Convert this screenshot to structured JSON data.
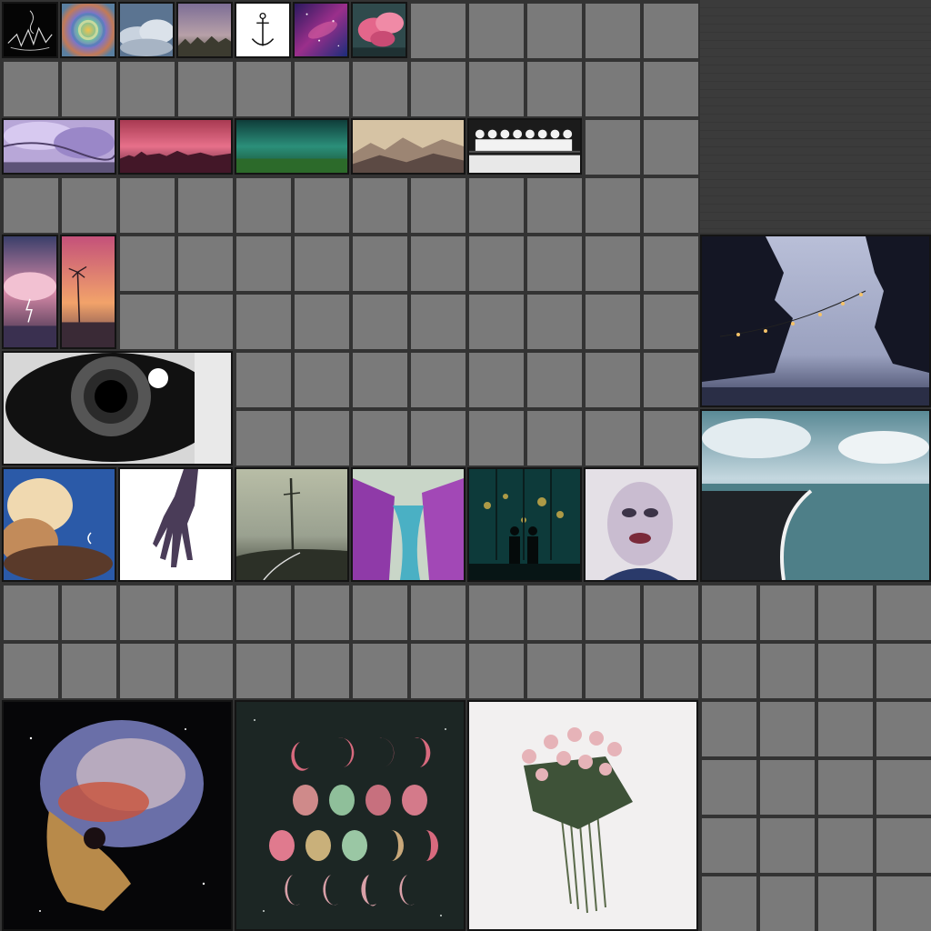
{
  "board": {
    "grid_color": "#333333",
    "cell_color": "#7a7a7a",
    "dark_area_color": "#3b3b3b",
    "tiles": [
      {
        "name": "sketch-tile",
        "icon": "line-sketch"
      },
      {
        "name": "iridescent-swirl-tile",
        "icon": "swirl"
      },
      {
        "name": "clouds-tile",
        "icon": "clouds"
      },
      {
        "name": "purple-haze-tile",
        "icon": "haze"
      },
      {
        "name": "anchor-tile",
        "icon": "anchor-icon"
      },
      {
        "name": "galaxy-tile",
        "icon": "galaxy"
      },
      {
        "name": "pink-smoke-tile",
        "icon": "smoke"
      },
      {
        "name": "blossom-branch-tile",
        "icon": "blossoms"
      },
      {
        "name": "pink-sunset-city-tile",
        "icon": "city-sunset"
      },
      {
        "name": "green-aurora-field-tile",
        "icon": "aurora"
      },
      {
        "name": "mountain-dusk-tile",
        "icon": "mountains"
      },
      {
        "name": "stormtroopers-tile",
        "icon": "figures"
      },
      {
        "name": "storm-clouds-tile",
        "icon": "storm"
      },
      {
        "name": "palm-sunset-tile",
        "icon": "palm"
      },
      {
        "name": "eye-closeup-tile",
        "icon": "eye"
      },
      {
        "name": "lake-string-lights-tile",
        "icon": "string-lights"
      },
      {
        "name": "ocean-shore-tile",
        "icon": "ocean"
      },
      {
        "name": "cloud-tower-tile",
        "icon": "cumulus"
      },
      {
        "name": "hand-tile",
        "icon": "hand"
      },
      {
        "name": "foggy-road-pole-tile",
        "icon": "road-pole"
      },
      {
        "name": "purple-river-gorge-tile",
        "icon": "gorge"
      },
      {
        "name": "couple-window-city-tile",
        "icon": "couple"
      },
      {
        "name": "painted-face-tile",
        "icon": "face"
      },
      {
        "name": "nebula-skull-tile",
        "icon": "skull"
      },
      {
        "name": "moon-phases-tile",
        "icon": "moon-phases"
      },
      {
        "name": "rose-bouquet-tile",
        "icon": "roses"
      }
    ]
  }
}
